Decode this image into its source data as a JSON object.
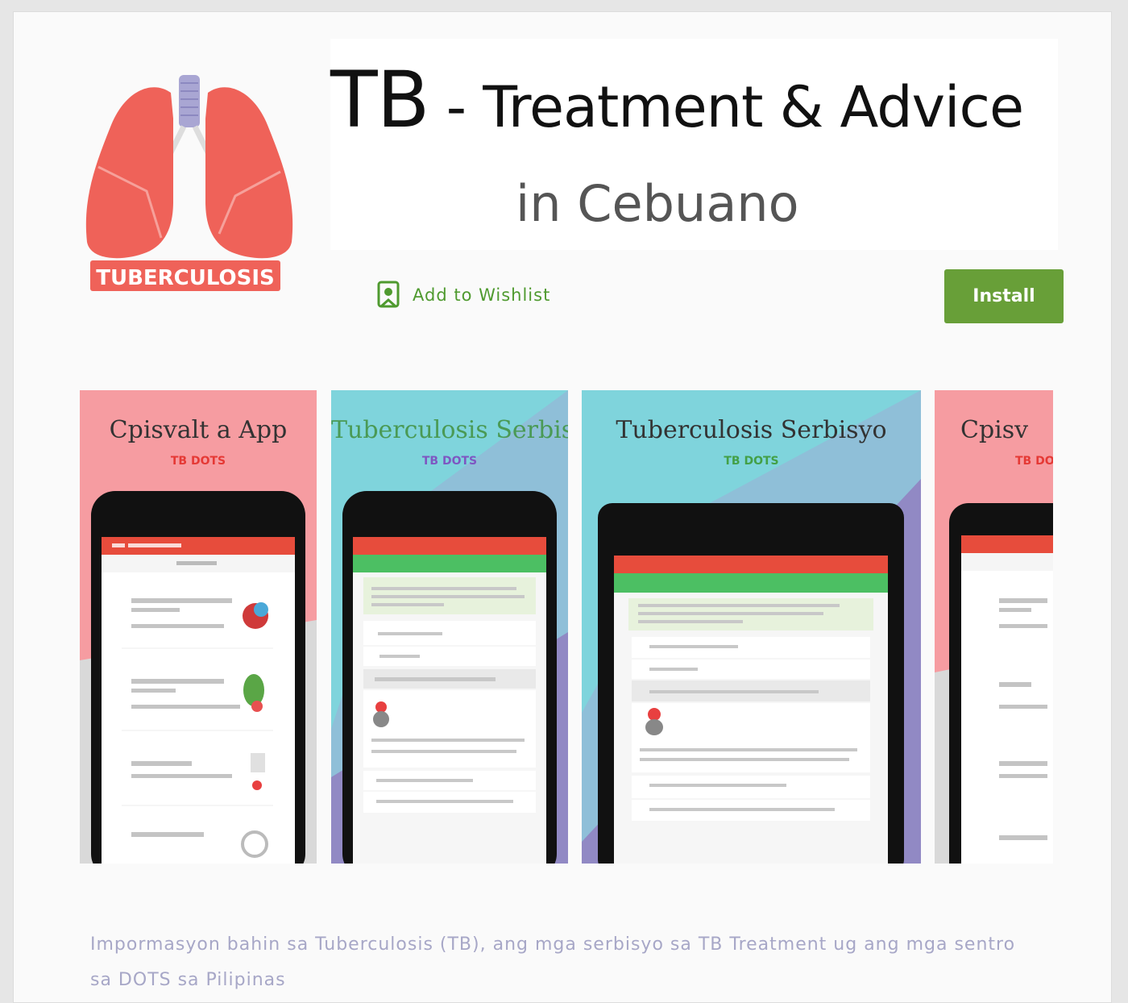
{
  "app": {
    "title_big": "TB",
    "title_rest": " - Treatment & Advice",
    "subtitle": "in Cebuano",
    "logo_text": "TUBERCULOSIS"
  },
  "actions": {
    "wishlist_label": "Add to Wishlist",
    "install_label": "Install"
  },
  "screenshots": [
    {
      "title": "Cpisvalt a App",
      "sub": "TB DOTS",
      "sub_color": "#e53935"
    },
    {
      "title": "Tuberculosis Serbisyo",
      "sub": "TB DOTS",
      "sub_color": "#7e57c2"
    },
    {
      "title": "Tuberculosis Serbisyo",
      "sub": "TB DOTS",
      "sub_color": "#43a047"
    },
    {
      "title": "Cpisv",
      "sub": "TB DO",
      "sub_color": "#e53935"
    }
  ],
  "description": "Impormasyon bahin sa Tuberculosis (TB), ang mga serbisyo sa TB Treatment ug ang mga sentro sa DOTS sa Pilipinas",
  "colors": {
    "install": "#689f38",
    "wishlist": "#4f9a2f",
    "lung": "#ef6259",
    "trachea": "#a9a6d3",
    "app_red": "#e74c3c",
    "app_green": "#4cbf63"
  }
}
